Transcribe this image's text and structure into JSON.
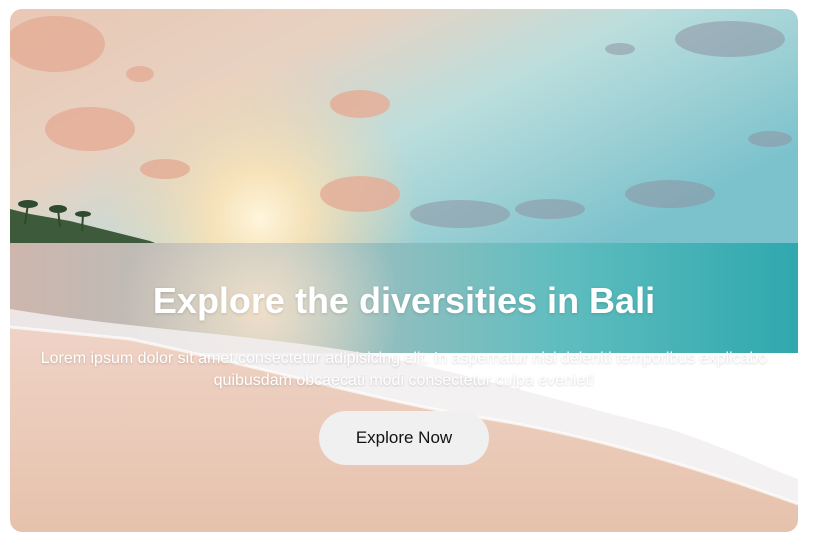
{
  "hero": {
    "title": "Explore the diversities in Bali",
    "description": "Lorem ipsum dolor sit amet consectetur adipisicing elit. In aspernatur nisi deleniti temporibus explicabo quibusdam obcaecati modi consectetur culpa eveniet!",
    "cta_label": "Explore Now",
    "background_image": "beach-sunset-photo"
  },
  "colors": {
    "title_text": "#ffffff",
    "button_bg": "#f0f0f0",
    "button_text": "#111111"
  }
}
